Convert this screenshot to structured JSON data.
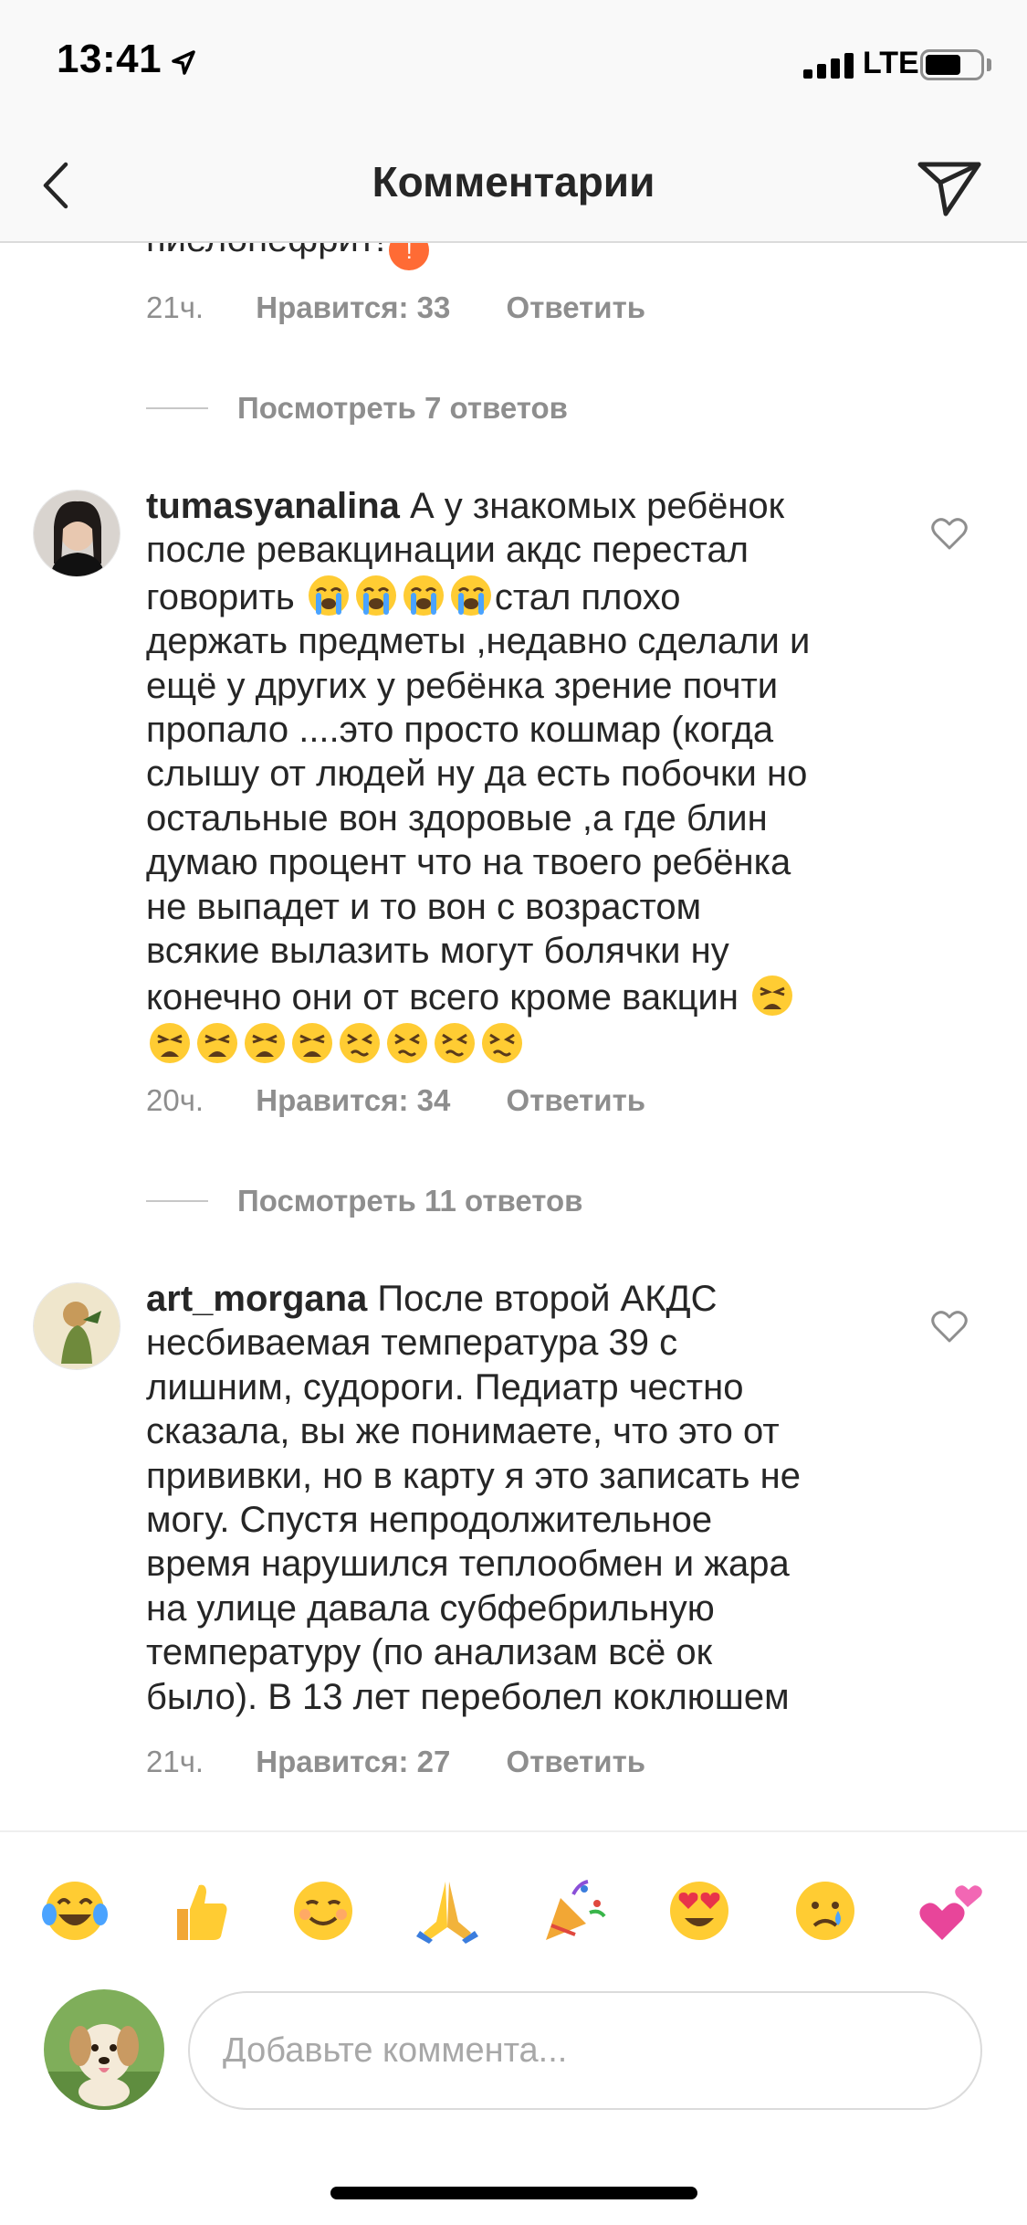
{
  "status_bar": {
    "time": "13:41",
    "network": "LTE"
  },
  "header": {
    "title": "Комментарии"
  },
  "top_comment_tail": {
    "text_cut": "пиелонефрит!",
    "time": "21ч.",
    "likes": "Нравится: 33",
    "reply": "Ответить",
    "view_replies": "Посмотреть 7 ответов"
  },
  "comments": [
    {
      "username": "tumasyanalina",
      "lines": [
        " А у знакомых ребёнок",
        "после ревакцинации акдс перестал",
        "говорить ",
        "стал плохо",
        "держать предметы ,недавно сделали и",
        "ещё у других у ребёнка зрение почти",
        "пропало ....это просто кошмар (когда",
        "слышу от людей ну да есть побочки но",
        "остальные вон здоровые ,а где блин",
        "думаю процент что на твоего ребёнка",
        "не выпадет и то вон с возрастом",
        "всякие вылазить могут болячки ну",
        "конечно они от всего кроме вакцин "
      ],
      "time": "20ч.",
      "likes": "Нравится: 34",
      "reply": "Ответить",
      "view_replies": "Посмотреть 11 ответов"
    },
    {
      "username": "art_morgana",
      "lines": [
        " После второй АКДС",
        "несбиваемая температура 39 с",
        "лишним, судороги. Педиатр честно",
        "сказала, вы же понимаете, что это от",
        "прививки, но в карту я это записать не",
        "могу. Спустя непродолжительное",
        "время нарушился теплообмен и жара",
        "на улице давала субфебрильную",
        "температуру (по анализам всё ок",
        "было). В 13 лет переболел коклюшем"
      ],
      "time": "21ч.",
      "likes": "Нравится: 27",
      "reply": "Ответить"
    }
  ],
  "emoji_bar": [
    "tears-of-joy-emoji-icon",
    "thumbs-up-emoji-icon",
    "smiling-emoji-icon",
    "folded-hands-emoji-icon",
    "party-popper-emoji-icon",
    "heart-eyes-emoji-icon",
    "crying-emoji-icon",
    "two-hearts-emoji-icon"
  ],
  "input": {
    "placeholder": "Добавьте коммента..."
  },
  "colors": {
    "text": "#262626",
    "secondary": "#8e8e8e",
    "border": "#dbdbdb",
    "header_bg": "#f9f9f9"
  }
}
